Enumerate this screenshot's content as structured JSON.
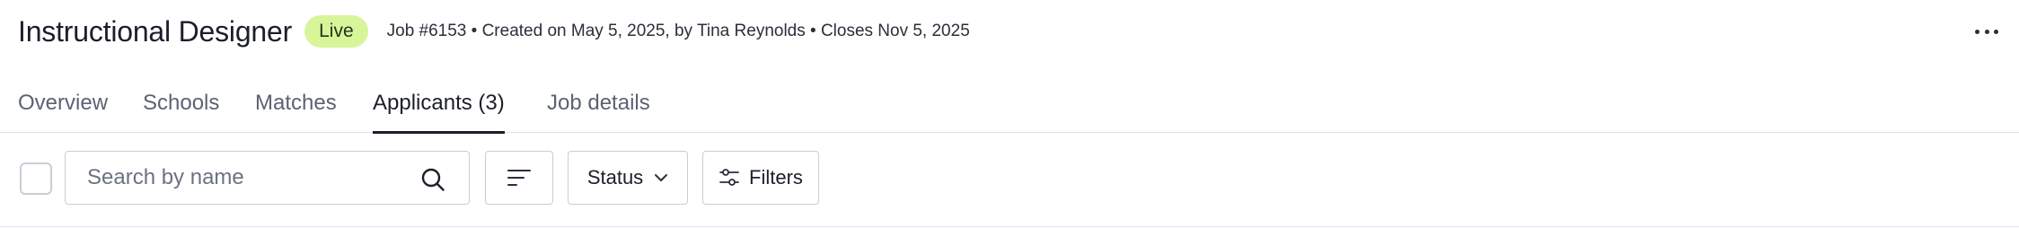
{
  "job": {
    "title": "Instructional Designer",
    "status_badge": "Live",
    "meta": "Job #6153 • Created on May 5, 2025, by Tina Reynolds • Closes Nov 5, 2025"
  },
  "tabs": [
    {
      "label": "Overview",
      "active": false
    },
    {
      "label": "Schools",
      "active": false
    },
    {
      "label": "Matches",
      "active": false
    },
    {
      "label": "Applicants (3)",
      "active": true
    },
    {
      "label": "Job details",
      "active": false
    }
  ],
  "toolbar": {
    "search_placeholder": "Search by name",
    "status_label": "Status",
    "filters_label": "Filters"
  },
  "icons": {
    "more": "more-horizontal-icon",
    "search": "search-icon",
    "sort": "sort-icon",
    "chevron": "chevron-down-icon",
    "filters": "sliders-icon"
  },
  "colors": {
    "badge_bg": "#d9f59a",
    "active_tab": "#1c1f2a",
    "inactive_tab": "#5b6273"
  }
}
